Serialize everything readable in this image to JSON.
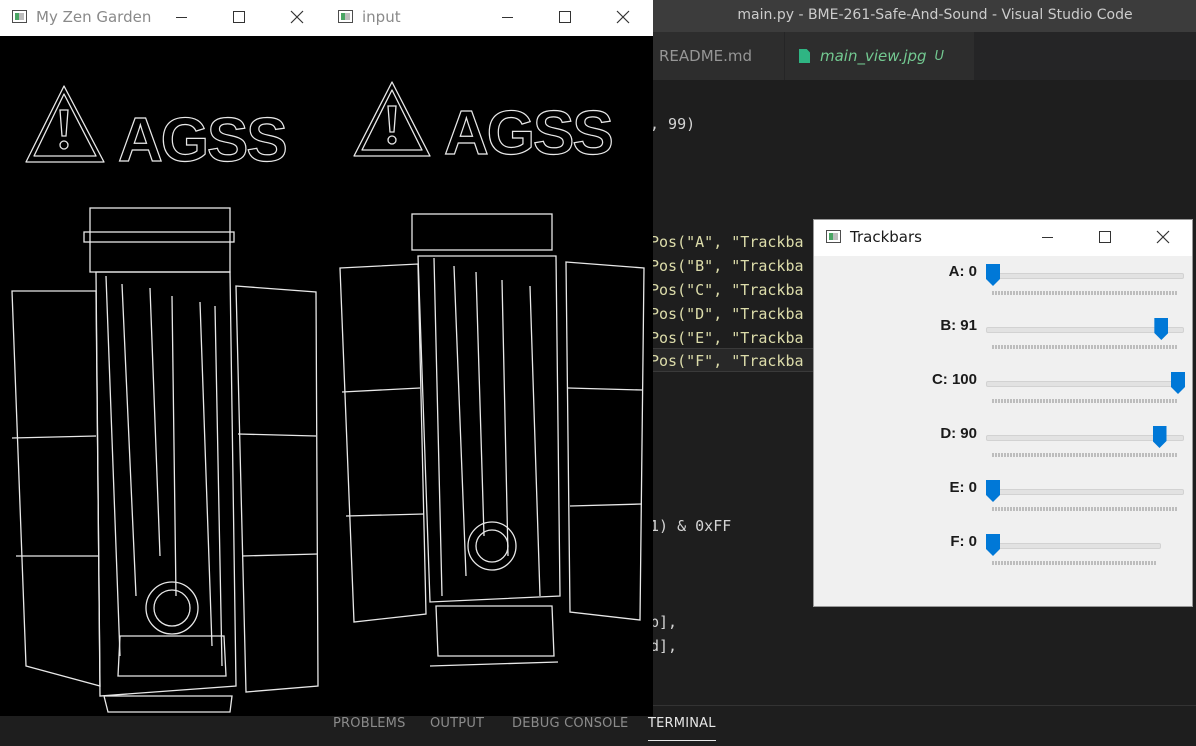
{
  "vscode": {
    "title": "main.py - BME-261-Safe-And-Sound - Visual Studio Code",
    "tabs": [
      {
        "label": "README.md"
      },
      {
        "label": "main_view.jpg",
        "badge": "U"
      }
    ],
    "code_lines": [
      {
        "text": ", 99)"
      },
      {
        "text": "Pos(\"A\", \"Trackba"
      },
      {
        "text": "Pos(\"B\", \"Trackba"
      },
      {
        "text": "Pos(\"C\", \"Trackba"
      },
      {
        "text": "Pos(\"D\", \"Trackba"
      },
      {
        "text": "Pos(\"E\", \"Trackba"
      },
      {
        "text": "Pos(\"F\", \"Trackba"
      },
      {
        "text": "1) & 0xFF"
      },
      {
        "text": "p],"
      },
      {
        "text": "d],"
      }
    ],
    "panel_tabs": [
      "PROBLEMS",
      "OUTPUT",
      "DEBUG CONSOLE",
      "TERMINAL"
    ],
    "active_panel_tab": "TERMINAL"
  },
  "windows": {
    "zen": {
      "title": "My Zen Garden",
      "sign_text": "AGSS"
    },
    "input": {
      "title": "input",
      "sign_text": "AGSS"
    },
    "trackbars": {
      "title": "Trackbars",
      "sliders": [
        {
          "label": "A: 0",
          "value": 0,
          "max": 100
        },
        {
          "label": "B: 91",
          "value": 91,
          "max": 100
        },
        {
          "label": "C: 100",
          "value": 100,
          "max": 100
        },
        {
          "label": "D: 90",
          "value": 90,
          "max": 100
        },
        {
          "label": "E: 0",
          "value": 0,
          "max": 100
        },
        {
          "label": "F: 0",
          "value": 0,
          "max": 100
        }
      ]
    }
  },
  "colors": {
    "accent": "#0078d7",
    "vscode_bg": "#1e1e1e"
  }
}
